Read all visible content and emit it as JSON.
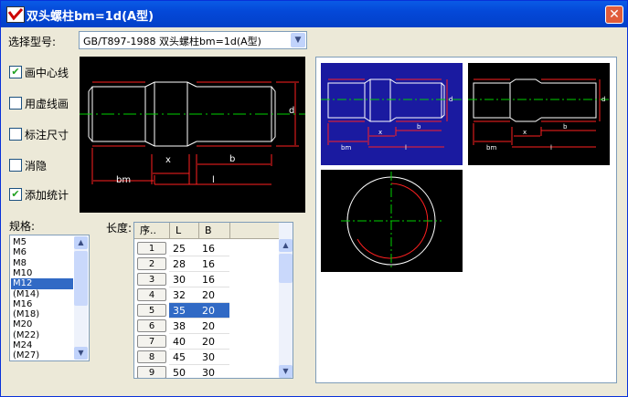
{
  "window": {
    "title": "双头螺柱bm=1d(A型)",
    "close_glyph": "✕"
  },
  "model_selector": {
    "label": "选择型号:",
    "value": "GB/T897-1988 双头螺柱bm=1d(A型)",
    "arrow": "▼"
  },
  "options": [
    {
      "label": "画中心线",
      "checked": true
    },
    {
      "label": "用虚线画",
      "checked": false
    },
    {
      "label": "标注尺寸",
      "checked": false
    },
    {
      "label": "消隐",
      "checked": false
    },
    {
      "label": "添加统计",
      "checked": true
    }
  ],
  "check_glyph": "✔",
  "main_drawing": {
    "dim_d": "d",
    "dim_x": "x",
    "dim_b": "b",
    "dim_bm": "bm",
    "dim_l": "l"
  },
  "thumb_a": {
    "bm": "bm",
    "x": "x",
    "b": "b",
    "l": "l",
    "d": "d"
  },
  "thumb_b": {
    "bm": "bm",
    "x": "x",
    "b": "b",
    "l": "l",
    "d": "d"
  },
  "spec": {
    "label": "规格:",
    "items": [
      "M5",
      "M6",
      "M8",
      "M10",
      "M12",
      "(M14)",
      "M16",
      "(M18)",
      "M20",
      "(M22)",
      "M24",
      "(M27)"
    ],
    "selected_index": 4
  },
  "length": {
    "label": "长度:",
    "columns": [
      "序..",
      "L",
      "B"
    ],
    "rows": [
      {
        "no": "1",
        "L": "25",
        "B": "16"
      },
      {
        "no": "2",
        "L": "28",
        "B": "16"
      },
      {
        "no": "3",
        "L": "30",
        "B": "16"
      },
      {
        "no": "4",
        "L": "32",
        "B": "20"
      },
      {
        "no": "5",
        "L": "35",
        "B": "20"
      },
      {
        "no": "6",
        "L": "38",
        "B": "20"
      },
      {
        "no": "7",
        "L": "40",
        "B": "20"
      },
      {
        "no": "8",
        "L": "45",
        "B": "30"
      },
      {
        "no": "9",
        "L": "50",
        "B": "30"
      }
    ],
    "selected_index": 4
  },
  "scroll": {
    "up": "▲",
    "down": "▼"
  },
  "colors": {
    "outline": "#ffffff",
    "thread": "#ff2020",
    "center": "#00d000",
    "dim": "#ff2020",
    "selected_view_bg": "#1a1aa0",
    "selection": "#316ac5"
  }
}
